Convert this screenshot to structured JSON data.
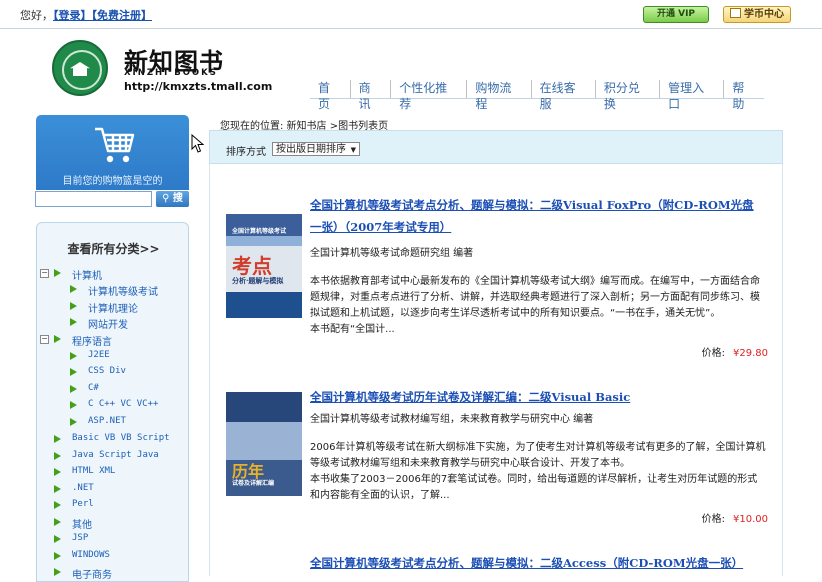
{
  "topbar": {
    "greeting": "您好，",
    "login": "【登录】",
    "register": "【免费注册】",
    "vip_button": "开通 VIP",
    "coin_button": "学币中心"
  },
  "brand": {
    "name_cn": "新知图书",
    "name_en": "XINZHI BOOKS",
    "url": "http://kmxzts.tmall.com"
  },
  "nav": [
    "首页",
    "商讯",
    "个性化推荐",
    "购物流程",
    "在线客服",
    "积分兑换",
    "管理入口",
    "帮助"
  ],
  "cart": {
    "text": "目前您的购物篮是空的"
  },
  "search": {
    "button": "搜"
  },
  "categories": {
    "title": "查看所有分类>>",
    "items": [
      {
        "label": "计算机",
        "level": 0,
        "expanded": true
      },
      {
        "label": "计算机等级考试",
        "level": 1
      },
      {
        "label": "计算机理论",
        "level": 1
      },
      {
        "label": "网站开发",
        "level": 1
      },
      {
        "label": "程序语言",
        "level": 0,
        "expanded": true
      },
      {
        "label": "J2EE",
        "level": 1
      },
      {
        "label": "CSS Div",
        "level": 1
      },
      {
        "label": "C#",
        "level": 1
      },
      {
        "label": "C C++ VC VC++",
        "level": 1
      },
      {
        "label": "ASP.NET",
        "level": 1
      },
      {
        "label": "Basic VB VB Script",
        "level": 0
      },
      {
        "label": "Java Script Java",
        "level": 0
      },
      {
        "label": "HTML XML",
        "level": 0
      },
      {
        "label": ".NET",
        "level": 0
      },
      {
        "label": "Perl",
        "level": 0
      },
      {
        "label": "其他",
        "level": 0
      },
      {
        "label": "JSP",
        "level": 0
      },
      {
        "label": "WINDOWS",
        "level": 0
      },
      {
        "label": "电子商务",
        "level": 0
      }
    ]
  },
  "breadcrumb": "您现在的位置: 新知书店 >图书列表页",
  "sort": {
    "label": "排序方式",
    "selected": "按出版日期排序"
  },
  "books": [
    {
      "title_line1": "全国计算机等级考试考点分析、题解与模拟：二级Visual FoxPro（附CD-ROM光盘",
      "title_line2": "一张）（2007年考试专用）",
      "author": "全国计算机等级考试命题研究组 编著",
      "desc": "本书依据教育部考试中心最新发布的《全国计算机等级考试大纲》编写而成。在编写中，一方面结合命题规律，对重点考点进行了分析、讲解，并选取经典考题进行了深入剖析；另一方面配有同步练习、模拟试题和上机试题，以逐步向考生详尽透析考试中的所有知识要点。“一书在手，通关无忧”。",
      "desc2": "本书配有“全国计...",
      "price_label": "价格:",
      "price": "¥29.80"
    },
    {
      "title_line1": "全国计算机等级考试历年试卷及详解汇编：二级Visual Basic",
      "author": "全国计算机等级考试教材编写组，未来教育教学与研究中心 编著",
      "desc": "2006年计算机等级考试在新大纲标准下实施，为了使考生对计算机等级考试有更多的了解，全国计算机等级考试教材编写组和未来教育教学与研究中心联合设计、开发了本书。",
      "desc2": "本书收集了2003－2006年的7套笔试试卷。同时，给出每道题的详尽解析，让考生对历年试题的形式和内容能有全面的认识，了解...",
      "price_label": "价格:",
      "price": "¥10.00"
    },
    {
      "title_line1": "全国计算机等级考试考点分析、题解与模拟：二级Access（附CD-ROM光盘一张）"
    }
  ],
  "covers": [
    {
      "top": "全国计算机等级考试",
      "big": "考点",
      "sub": "分析·题解与模拟"
    },
    {
      "big": "历年",
      "sub": "试卷及详解汇编"
    }
  ]
}
